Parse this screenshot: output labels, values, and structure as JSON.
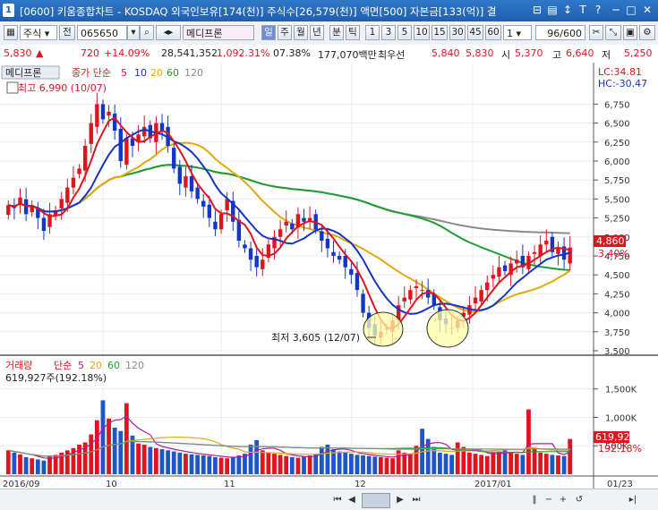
{
  "window": {
    "screen_no": "1",
    "title": "[0600] 키움종합차트 - KOSDAQ 외국인보유[174(천)] 주식수[26,579(천)] 액면[500] 자본금[133(억)] 결"
  },
  "toolbar": {
    "market_type": "주식",
    "mode": "전",
    "code": "065650",
    "stock_name": "메디프론",
    "periods": [
      "일",
      "주",
      "월",
      "년",
      "분",
      "틱"
    ],
    "intervals": [
      "1",
      "3",
      "5",
      "10",
      "15",
      "30",
      "45",
      "60"
    ],
    "interval_select": "1",
    "count": "96/600"
  },
  "info": {
    "price": "5,830",
    "arrow": "▲",
    "change": "720",
    "change_pct": "+14.09%",
    "volume": "28,541,352",
    "volume_ratio": "1,092.31%",
    "turnover": "07.38%",
    "amount": "177,070백만",
    "best_ask_label": "최우선",
    "best_ask_1": "5,840",
    "best_ask_2": "5,830",
    "open_label": "시",
    "open": "5,370",
    "high_label": "고",
    "high": "6,640",
    "low_label": "저",
    "low": "5,250"
  },
  "price_panel": {
    "name": "메디프론",
    "ma_label": "종가 단순",
    "ma_periods": [
      "5",
      "10",
      "20",
      "60",
      "120"
    ],
    "ma_colors": [
      "#e0141e",
      "#1733c4",
      "#e2a90e",
      "#1f9d32",
      "#8a8a8a"
    ],
    "high_marker": "최고 6,990 (10/07)",
    "low_marker": "최저 3,605 (12/07)",
    "lc": "LC:34.81",
    "hc": "HC:-30.47",
    "last_price": "4,860",
    "last_pct": "3.40%",
    "axis_ticks": [
      "6,750",
      "6,500",
      "6,250",
      "6,000",
      "5,750",
      "5,500",
      "5,250",
      "5,000",
      "4,750",
      "4,500",
      "4,250",
      "4,000",
      "3,750",
      "3,500"
    ]
  },
  "volume_panel": {
    "label": "거래량",
    "ma_label": "단순",
    "ma_periods": [
      "5",
      "20",
      "60",
      "120"
    ],
    "ma_colors": [
      "#b5179e",
      "#e2a90e",
      "#1f9d32",
      "#8a8a8a"
    ],
    "value_text": "619,927주(192.18%)",
    "last_value": "619,927",
    "last_pct": "192.18%",
    "axis_ticks": [
      "1,500K",
      "1,000K",
      "500K"
    ]
  },
  "x_axis": {
    "labels": [
      "2016/09",
      "10",
      "11",
      "12",
      "2017/01"
    ],
    "right_label": "01/23"
  },
  "chart_data": {
    "type": "candlestick",
    "x_start": "2016/09",
    "x_end": "2017/01",
    "ylim": [
      3500,
      6990
    ],
    "series": [
      {
        "name": "5",
        "color": "#e0141e"
      },
      {
        "name": "10",
        "color": "#1733c4"
      },
      {
        "name": "20",
        "color": "#e2a90e"
      },
      {
        "name": "60",
        "color": "#1f9d32"
      },
      {
        "name": "120",
        "color": "#8a8a8a"
      }
    ],
    "close_values": [
      5420,
      5380,
      5520,
      5300,
      5420,
      5250,
      5080,
      5300,
      5350,
      5500,
      5650,
      5780,
      5900,
      6200,
      6500,
      6750,
      6550,
      6650,
      6400,
      6000,
      6300,
      6200,
      6350,
      6450,
      6300,
      6500,
      6400,
      6200,
      5900,
      5700,
      5800,
      5600,
      5500,
      5400,
      5250,
      5100,
      5300,
      5500,
      5200,
      4950,
      4850,
      4700,
      4600,
      4700,
      4900,
      5000,
      5100,
      5200,
      5100,
      5300,
      5200,
      5250,
      5100,
      4950,
      4850,
      4750,
      4700,
      4600,
      4500,
      4300,
      4000,
      3800,
      3700,
      3750,
      3800,
      3900,
      4100,
      4200,
      4300,
      4350,
      4300,
      4200,
      4100,
      3900,
      3850,
      3800,
      3900,
      4000,
      4100,
      4200,
      4300,
      4400,
      4500,
      4600,
      4550,
      4650,
      4700,
      4600,
      4750,
      4800,
      4900,
      4950,
      4800,
      4850,
      4700,
      4860
    ],
    "volume_values": [
      420,
      380,
      350,
      300,
      280,
      260,
      240,
      310,
      340,
      380,
      420,
      460,
      520,
      560,
      700,
      950,
      1300,
      980,
      820,
      760,
      1250,
      680,
      540,
      520,
      480,
      460,
      440,
      420,
      400,
      380,
      360,
      350,
      340,
      330,
      320,
      300,
      290,
      280,
      300,
      330,
      360,
      520,
      600,
      420,
      380,
      360,
      340,
      320,
      300,
      290,
      310,
      330,
      360,
      480,
      520,
      440,
      400,
      380,
      360,
      340,
      330,
      320,
      310,
      300,
      290,
      280,
      420,
      380,
      360,
      500,
      800,
      620,
      480,
      380,
      360,
      340,
      560,
      480,
      380,
      360,
      340,
      320,
      380,
      400,
      420,
      380,
      360,
      340,
      1140,
      460,
      380,
      360,
      340,
      330,
      320,
      620
    ]
  }
}
